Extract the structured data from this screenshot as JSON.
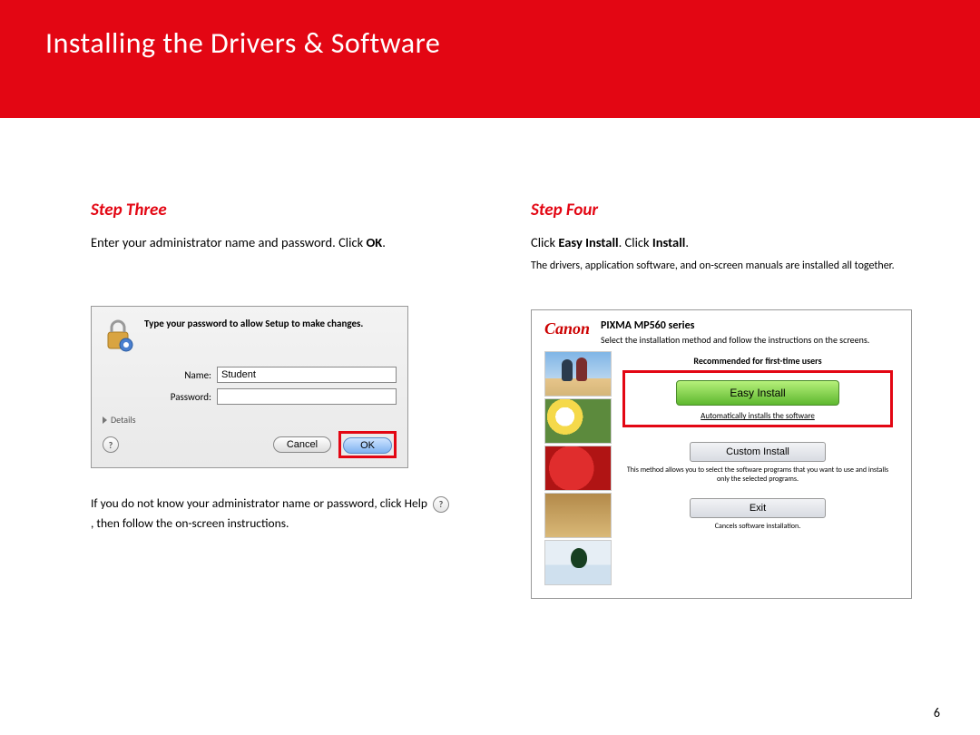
{
  "header": {
    "title": "Installing  the Drivers & Software"
  },
  "left": {
    "step_title": "Step Three",
    "instr_pre": "Enter your administrator name and password. Click ",
    "instr_bold": "OK",
    "instr_post": ".",
    "dialog": {
      "message": "Type your password to allow Setup to make changes.",
      "name_label": "Name:",
      "name_value": "Student",
      "password_label": "Password:",
      "password_value": "",
      "details_label": "Details",
      "help_glyph": "?",
      "cancel_label": "Cancel",
      "ok_label": "OK"
    },
    "note_pre": "If you do not know your administrator name or password, click Help ",
    "note_help_glyph": "?",
    "note_post": " , then follow the on-screen instructions."
  },
  "right": {
    "step_title": "Step Four",
    "instr_parts": [
      "Click ",
      "Easy Install",
      ". Click ",
      "Install",
      "."
    ],
    "subnote": "The drivers, application software, and on-screen manuals are installed all together.",
    "installer": {
      "brand": "Canon",
      "product": "PIXMA MP560 series",
      "product_sub": "Select the installation method and follow the instructions on the screens.",
      "recommended_label": "Recommended for first-time users",
      "easy_label": "Easy Install",
      "easy_sub": "Automatically installs the software",
      "custom_label": "Custom Install",
      "custom_sub": "This method allows you to select the software programs that you want to use and installs only the selected programs.",
      "exit_label": "Exit",
      "exit_sub": "Cancels software installation."
    }
  },
  "page_number": "6"
}
